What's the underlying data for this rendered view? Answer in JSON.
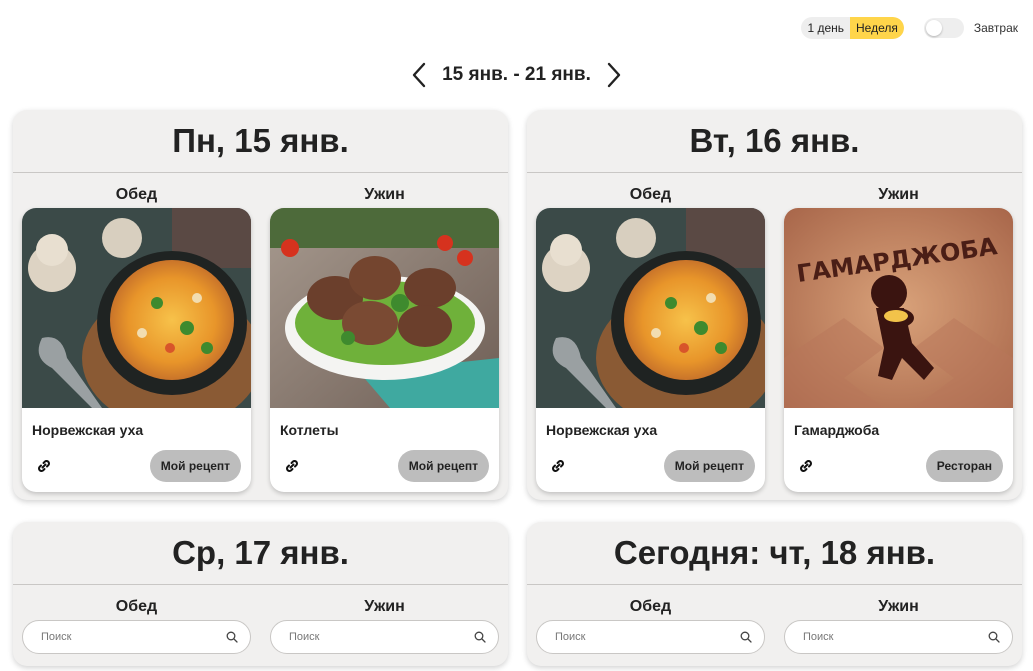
{
  "view_switch": {
    "day": "1 день",
    "week": "Неделя",
    "selected": "week"
  },
  "breakfast_toggle": {
    "label": "Завтрак",
    "on": false
  },
  "week_nav": {
    "range": "15 янв. - 21 янв.",
    "prev_icon": "chevron-left-icon",
    "next_icon": "chevron-right-icon"
  },
  "days": [
    {
      "title": "Пн, 15 янв.",
      "lunch": {
        "label": "Обед",
        "dish": "Норвежская уха",
        "button": "Мой рецепт"
      },
      "dinner": {
        "label": "Ужин",
        "dish": "Котлеты",
        "button": "Мой рецепт"
      }
    },
    {
      "title": "Вт, 16 янв.",
      "lunch": {
        "label": "Обед",
        "dish": "Норвежская уха",
        "button": "Мой рецепт"
      },
      "dinner": {
        "label": "Ужин",
        "dish": "Гамарджоба",
        "button": "Ресторан",
        "logo_text": "ГАМАРДЖОБА"
      }
    },
    {
      "title": "Ср, 17 янв.",
      "lunch": {
        "label": "Обед",
        "search_placeholder": "Поиск"
      },
      "dinner": {
        "label": "Ужин",
        "search_placeholder": "Поиск"
      }
    },
    {
      "title": "Сегодня: чт, 18 янв.",
      "lunch": {
        "label": "Обед",
        "search_placeholder": "Поиск"
      },
      "dinner": {
        "label": "Ужин",
        "search_placeholder": "Поиск"
      }
    }
  ],
  "colors": {
    "accent": "#ffd54a",
    "panel": "#f1f0ef",
    "button": "#bdbdbd"
  },
  "icons": {
    "link": "link-icon",
    "search": "search-icon"
  }
}
